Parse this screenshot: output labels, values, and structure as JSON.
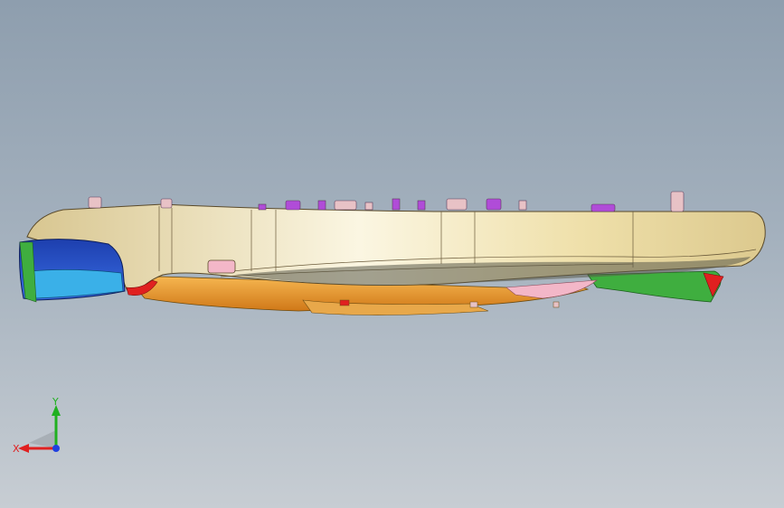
{
  "view": {
    "background_top": "#8e9eae",
    "background_bottom": "#c7cdd3"
  },
  "model": {
    "body_color": "#efe3b0",
    "lower_shell_color": "#f0a030",
    "end_cap_color": "#2a55c8",
    "end_cap_inner_color": "#3ab0e8",
    "rear_part_color": "#3fae3f",
    "accent_red": "#e02020",
    "pink_part": "#f3b7c8",
    "button_magenta": "#b04cd8"
  },
  "triad": {
    "x_label": "X",
    "y_label": "Y",
    "x_color": "#e02020",
    "y_color": "#20b020",
    "z_color": "#2040e0"
  }
}
